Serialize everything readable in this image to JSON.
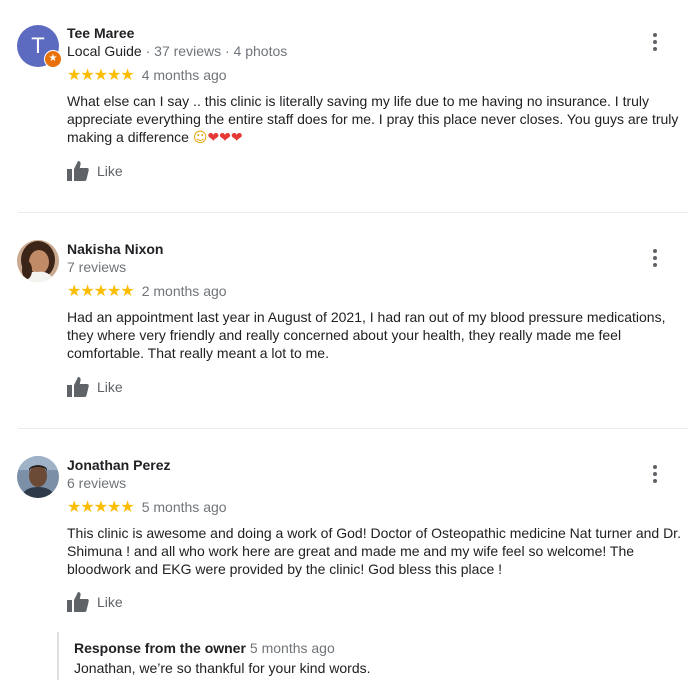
{
  "reviews": [
    {
      "name": "Tee Maree",
      "avatar_letter": "T",
      "meta_guide": "Local Guide",
      "meta_sep1": " · ",
      "meta_reviews": "37 reviews",
      "meta_sep2": " · ",
      "meta_photos": "4 photos",
      "stars": "★★★★★",
      "rating": 5,
      "date": "4 months ago",
      "text": "What else can I say .. this clinic is literally saving my life due to me having no insurance. I truly appreciate everything the entire staff does for me. I pray this place never closes. You guys are truly making a difference ",
      "emoji_smile": "☺",
      "emoji_hearts": "❤❤❤",
      "like_label": "Like"
    },
    {
      "name": "Nakisha Nixon",
      "meta_reviews": "7 reviews",
      "stars": "★★★★★",
      "rating": 5,
      "date": "2 months ago",
      "text": "Had an appointment last year in August of 2021, I had ran out of my blood pressure medications,  they where very friendly and really concerned about your health, they really made me feel comfortable. That really meant a lot to me.",
      "like_label": "Like"
    },
    {
      "name": "Jonathan Perez",
      "meta_reviews": "6 reviews",
      "stars": "★★★★★",
      "rating": 5,
      "date": "5 months ago",
      "text": "This clinic is awesome and doing a work of God! Doctor of Osteopathic medicine Nat turner and Dr. Shimuna ! and all who work here are great and made me and my wife feel so welcome! The bloodwork and EKG were provided by the clinic! God bless this place !",
      "like_label": "Like"
    }
  ],
  "owner_response": {
    "title": "Response from the owner",
    "date": "5 months ago",
    "text": "Jonathan, we’re so thankful for your kind words."
  },
  "colors": {
    "star": "#fbbc04",
    "secondary_text": "#70757a",
    "avatar_letter_bg": "#5c6bc0",
    "guide_badge": "#e8710a"
  },
  "icons": {
    "like": "thumbs-up-icon",
    "more": "more-vert-icon",
    "local_guide": "local-guide-badge-icon"
  }
}
